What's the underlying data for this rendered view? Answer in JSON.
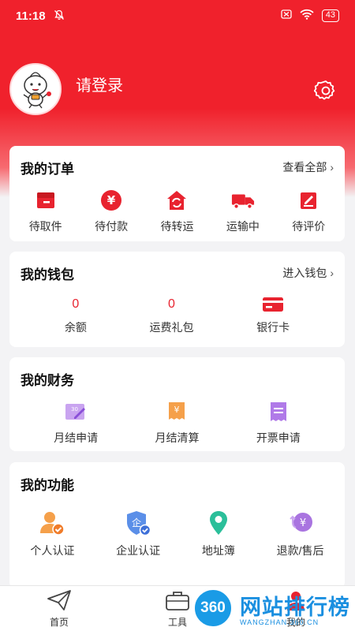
{
  "status": {
    "time": "11:18",
    "battery": "43"
  },
  "profile": {
    "login_text": "请登录"
  },
  "orders": {
    "title": "我的订单",
    "link": "查看全部",
    "items": [
      {
        "label": "待取件",
        "icon": "box-icon"
      },
      {
        "label": "待付款",
        "icon": "yen-coin-icon"
      },
      {
        "label": "待转运",
        "icon": "house-transfer-icon"
      },
      {
        "label": "运输中",
        "icon": "truck-icon"
      },
      {
        "label": "待评价",
        "icon": "edit-note-icon"
      }
    ]
  },
  "wallet": {
    "title": "我的钱包",
    "link": "进入钱包",
    "items": [
      {
        "value": "0",
        "label": "余额"
      },
      {
        "value": "0",
        "label": "运费礼包"
      },
      {
        "label": "银行卡",
        "icon": "bank-card-icon"
      }
    ]
  },
  "finance": {
    "title": "我的财务",
    "items": [
      {
        "label": "月结申请",
        "icon": "monthly-apply-icon",
        "badge": "30"
      },
      {
        "label": "月结清算",
        "icon": "monthly-settle-icon",
        "badge": "¥"
      },
      {
        "label": "开票申请",
        "icon": "invoice-icon"
      }
    ]
  },
  "functions": {
    "title": "我的功能",
    "items": [
      {
        "label": "个人认证",
        "icon": "personal-verify-icon"
      },
      {
        "label": "企业认证",
        "icon": "enterprise-verify-icon",
        "badge": "企"
      },
      {
        "label": "地址簿",
        "icon": "location-pin-icon"
      },
      {
        "label": "退款/售后",
        "icon": "refund-icon",
        "badge": "¥"
      }
    ]
  },
  "tabbar": {
    "items": [
      {
        "label": "首页",
        "icon": "send-plane-icon"
      },
      {
        "label": "工具",
        "icon": "toolbox-icon"
      },
      {
        "label": "我的",
        "icon": "user-icon"
      }
    ]
  },
  "watermark": {
    "brand": "360",
    "text": "网站排行榜",
    "sub": "WANGZHAN.360.CN"
  },
  "colors": {
    "brand_red": "#f0212c",
    "accent_orange": "#f5a04a",
    "blue": "#3d7fe0",
    "purple": "#a974e0",
    "teal": "#2bbf9a"
  }
}
